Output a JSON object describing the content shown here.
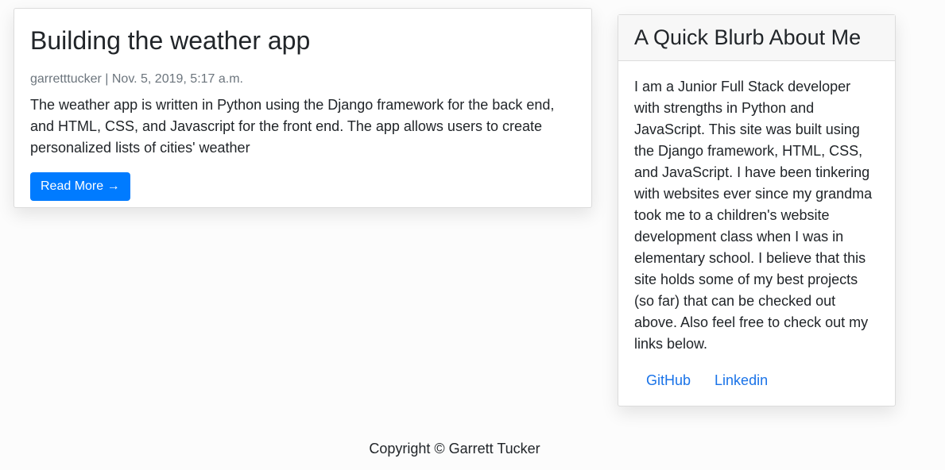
{
  "post": {
    "title": "Building the weather app",
    "meta": "garretttucker | Nov. 5, 2019, 5:17 a.m.",
    "excerpt": "The weather app is written in Python using the Django framework for the back end, and HTML, CSS, and Javascript for the front end. The app allows users to create personalized lists of cities' weather",
    "read_more_label": "Read More →"
  },
  "sidebar": {
    "title": "A Quick Blurb About Me",
    "text": "I am a Junior Full Stack developer with strengths in Python and JavaScript. This site was built using the Django framework, HTML, CSS, and JavaScript. I have been tinkering with websites ever since my grandma took me to a children's website development class when I was in elementary school. I believe that this site holds some of my best projects (so far) that can be checked out above. Also feel free to check out my links below.",
    "links": [
      {
        "label": "GitHub"
      },
      {
        "label": "Linkedin"
      }
    ]
  },
  "footer": {
    "copyright": "Copyright © Garrett Tucker"
  },
  "colors": {
    "accent": "#007bff",
    "link": "#1a73e8",
    "meta_text": "#6c757d"
  }
}
